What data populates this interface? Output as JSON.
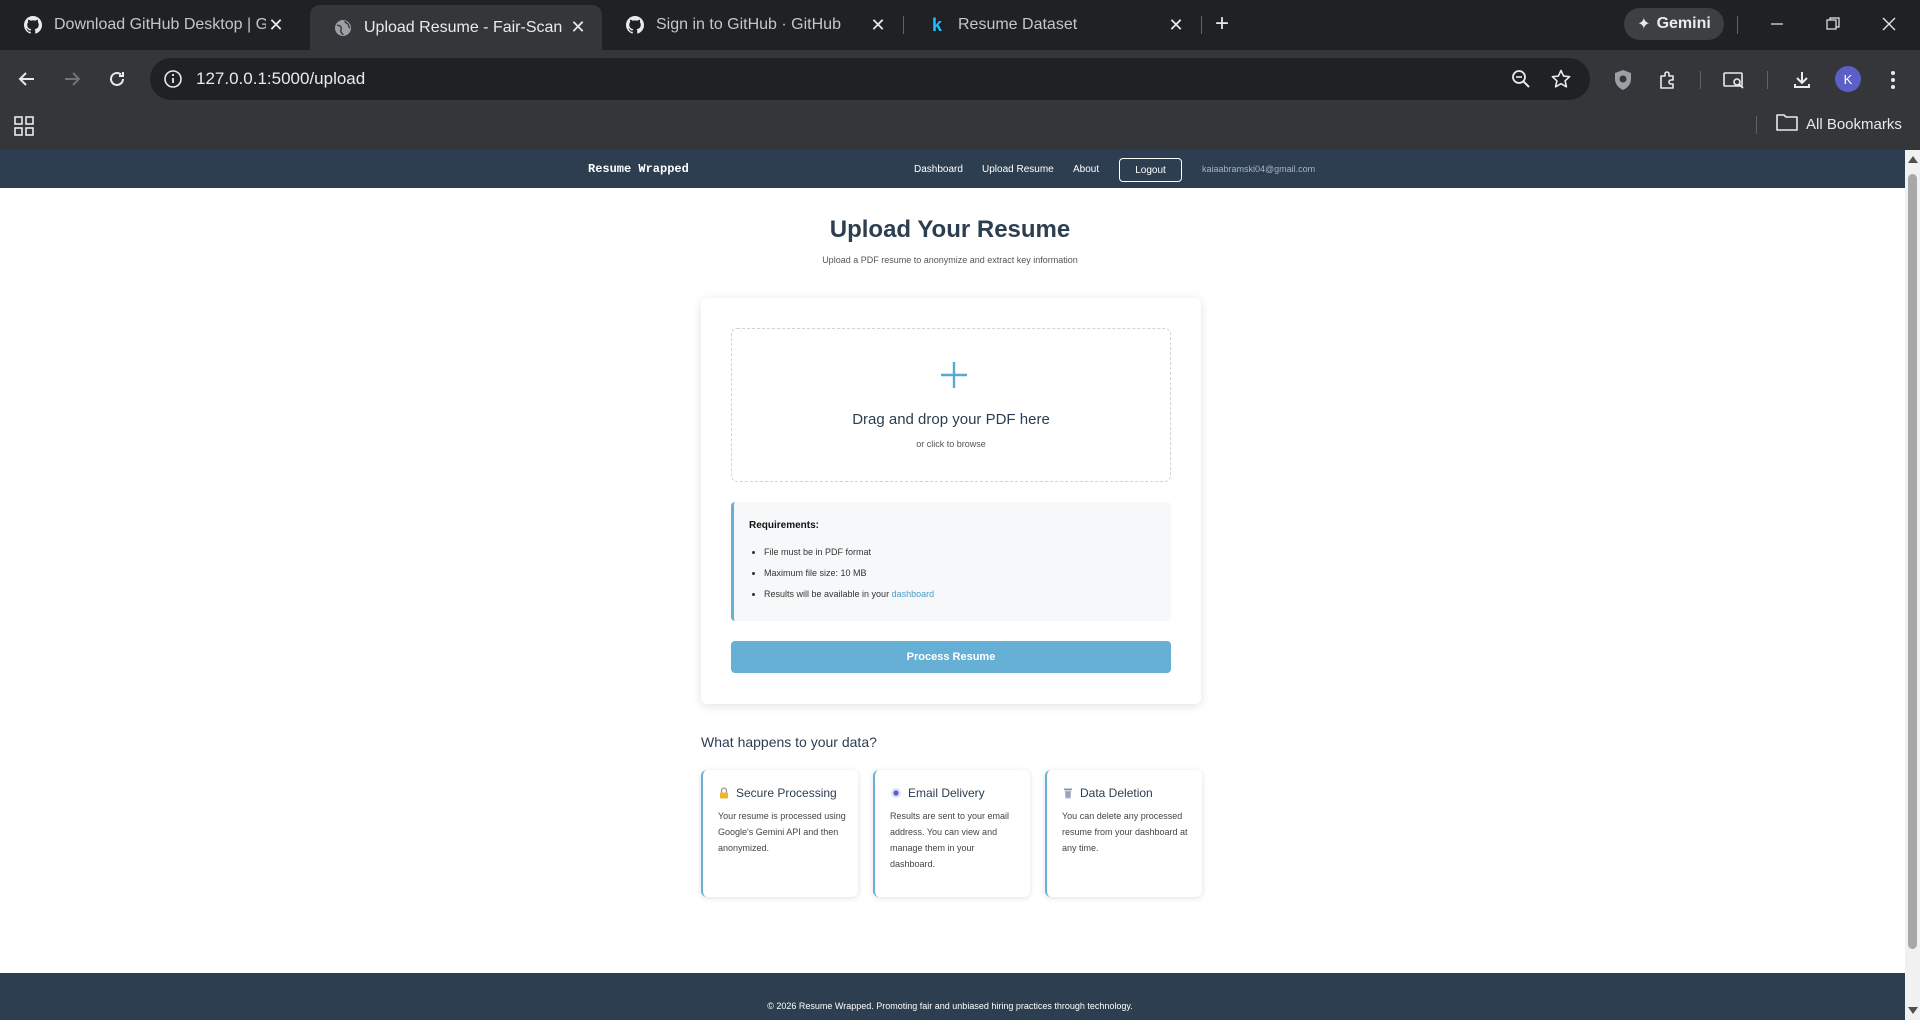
{
  "browser": {
    "tabs": [
      {
        "title": "Download GitHub Desktop | GitHub",
        "icon": "github-icon",
        "active": false
      },
      {
        "title": "Upload Resume - Fair-Scan",
        "icon": "globe-icon",
        "active": true
      },
      {
        "title": "Sign in to GitHub · GitHub",
        "icon": "github-icon",
        "active": false
      },
      {
        "title": "Resume Dataset",
        "icon": "kaggle-icon",
        "active": false
      }
    ],
    "gemini_label": "Gemini",
    "url": "127.0.0.1:5000/upload",
    "profile_initial": "K",
    "bookmarks_label": "All Bookmarks"
  },
  "site": {
    "brand": "Resume Wrapped",
    "nav": {
      "dashboard": "Dashboard",
      "upload": "Upload Resume",
      "about": "About",
      "logout": "Logout",
      "email": "kaiaabramski04@gmail.com"
    },
    "title": "Upload Your Resume",
    "subtitle": "Upload a PDF resume to anonymize and extract key information",
    "dropzone": {
      "title": "Drag and drop your PDF here",
      "subtitle": "or click to browse"
    },
    "requirements": {
      "title": "Requirements:",
      "item1": "File must be in PDF format",
      "item2": "Maximum file size: 10 MB",
      "item3_prefix": "Results will be available in your ",
      "item3_link": "dashboard"
    },
    "process_button": "Process Resume",
    "data_section_title": "What happens to your data?",
    "info_cards": [
      {
        "icon": "lock-icon",
        "title": "Secure Processing",
        "body": "Your resume is processed using Google's Gemini API and then anonymized."
      },
      {
        "icon": "email-icon",
        "title": "Email Delivery",
        "body": "Results are sent to your email address. You can view and manage them in your dashboard."
      },
      {
        "icon": "trash-icon",
        "title": "Data Deletion",
        "body": "You can delete any processed resume from your dashboard at any time."
      }
    ],
    "footer": "© 2026 Resume Wrapped. Promoting fair and unbiased hiring practices through technology."
  },
  "colors": {
    "nav_bg": "#2c3e50",
    "accent": "#66b0d5",
    "link": "#4a9cc7"
  }
}
